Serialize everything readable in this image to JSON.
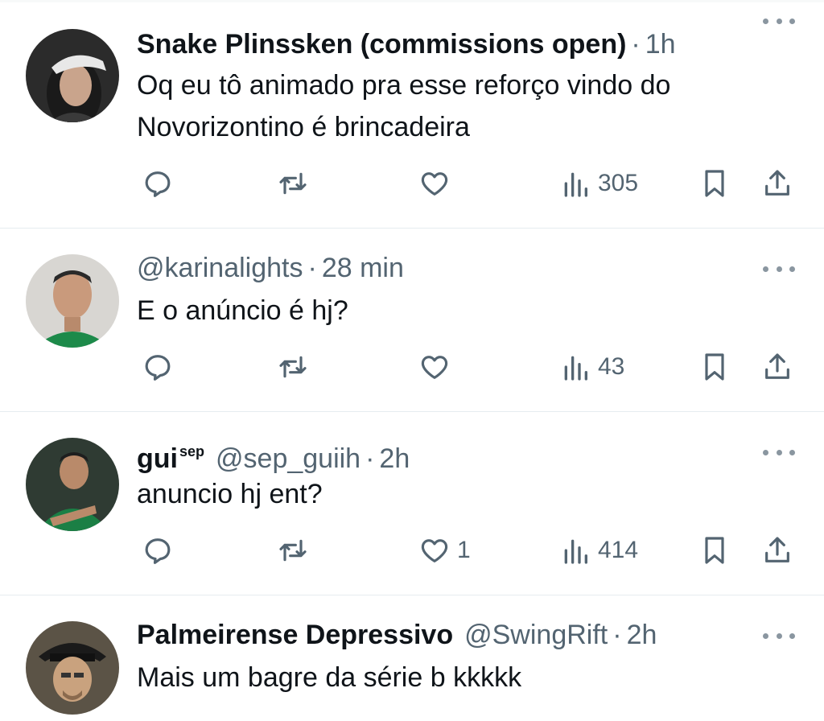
{
  "tweets": [
    {
      "name": "Snake Plinssken (commissions open)",
      "name_sup": "",
      "handle": "",
      "separator": "·",
      "time": "1h",
      "text_lines": [
        "Oq eu tô animado pra esse reforço vindo do",
        "Novorizontino é brincadeira"
      ],
      "replies": "",
      "retweets": "",
      "likes": "",
      "views": "305"
    },
    {
      "name": "",
      "name_sup": "",
      "handle": "@karinalights",
      "separator": "·",
      "time": "28 min",
      "text_lines": [
        "E o anúncio é hj?"
      ],
      "replies": "",
      "retweets": "",
      "likes": "",
      "views": "43"
    },
    {
      "name": "gui",
      "name_sup": "sep",
      "handle": "@sep_guiih",
      "separator": "·",
      "time": "2h",
      "text_lines": [
        "anuncio hj ent?"
      ],
      "replies": "",
      "retweets": "",
      "likes": "1",
      "views": "414"
    },
    {
      "name": "Palmeirense Depressivo",
      "name_sup": "",
      "handle": "@SwingRift",
      "separator": "·",
      "time": "2h",
      "text_lines": [
        "Mais um bagre da série b kkkkk"
      ],
      "replies": "",
      "retweets": "",
      "likes": "",
      "views": ""
    }
  ],
  "icons": {
    "reply": "reply-icon",
    "retweet": "retweet-icon",
    "like": "heart-icon",
    "views": "views-icon",
    "bookmark": "bookmark-icon",
    "share": "share-icon",
    "more": "more-icon"
  },
  "colors": {
    "text": "#0f1419",
    "secondary": "#536471",
    "divider": "#e6ecf0"
  }
}
